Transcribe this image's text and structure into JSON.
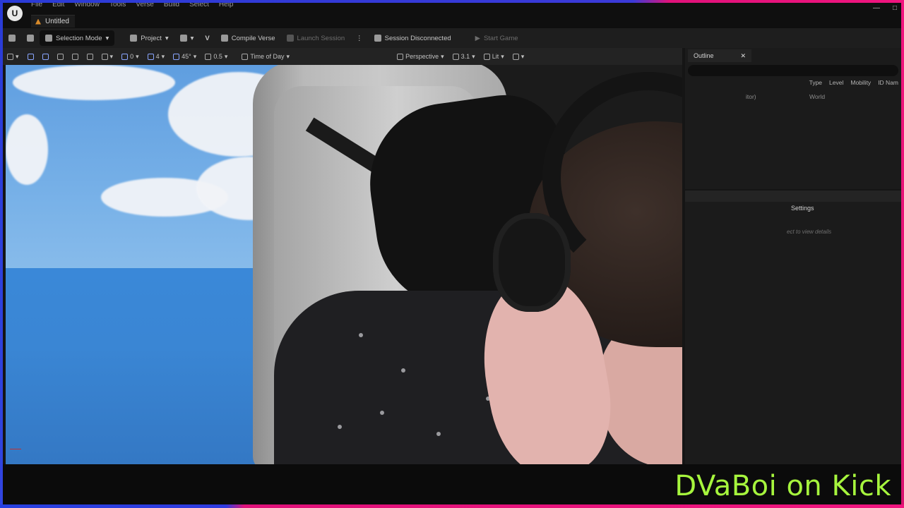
{
  "app": {
    "menu": [
      "File",
      "Edit",
      "Window",
      "Tools",
      "Verse",
      "Build",
      "Select",
      "Help"
    ],
    "document_tab": "Untitled"
  },
  "toolbar": {
    "selection_mode": "Selection Mode",
    "project": "Project",
    "compile_verse": "Compile Verse",
    "launch_session": "Launch Session",
    "session_status": "Session Disconnected",
    "start_game": "Start Game"
  },
  "viewport_toolbar": {
    "rotation_snap": "0",
    "grid_snap": "4",
    "angle_snap": "45°",
    "scale_snap": "0.5",
    "time_of_day": "Time of Day",
    "view_mode": "Perspective",
    "speed": "3.1",
    "lighting": "Lit"
  },
  "outliner": {
    "tab_label": "Outline",
    "columns": [
      "Type",
      "Level",
      "Mobility",
      "ID Nam"
    ],
    "row_name_fragment": "itor)",
    "row_type": "World"
  },
  "details": {
    "settings_tab": "Settings",
    "hint": "ect to view details"
  },
  "overlay": {
    "caption": "DVaBoi on Kick",
    "caption_color": "#a6f53d"
  }
}
